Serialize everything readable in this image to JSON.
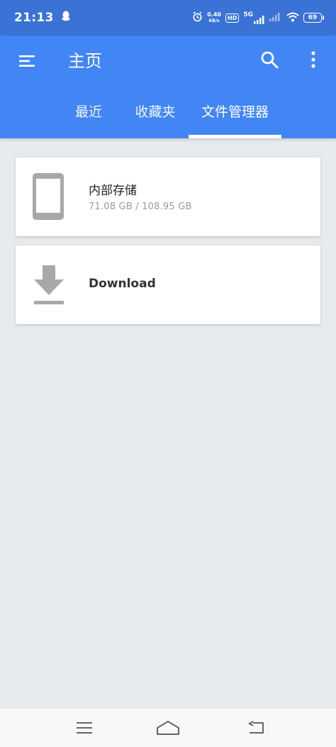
{
  "status_bar": {
    "time": "21:13",
    "net_speed_value": "0.40",
    "net_speed_unit": "KB/s",
    "hd_label": "HD",
    "network_type": "5G",
    "battery": "69"
  },
  "app_bar": {
    "title": "主页"
  },
  "tabs": [
    {
      "label": "最近",
      "active": false
    },
    {
      "label": "收藏夹",
      "active": false
    },
    {
      "label": "文件管理器",
      "active": true
    }
  ],
  "storage_items": [
    {
      "title": "内部存储",
      "subtitle": "71.08 GB / 108.95 GB",
      "icon": "phone-icon"
    },
    {
      "title": "Download",
      "icon": "download-icon"
    }
  ],
  "colors": {
    "status_bar": "#3a72d6",
    "app_bar": "#4285f4",
    "background": "#e6eaed",
    "icon_gray": "#a8a8a8"
  }
}
